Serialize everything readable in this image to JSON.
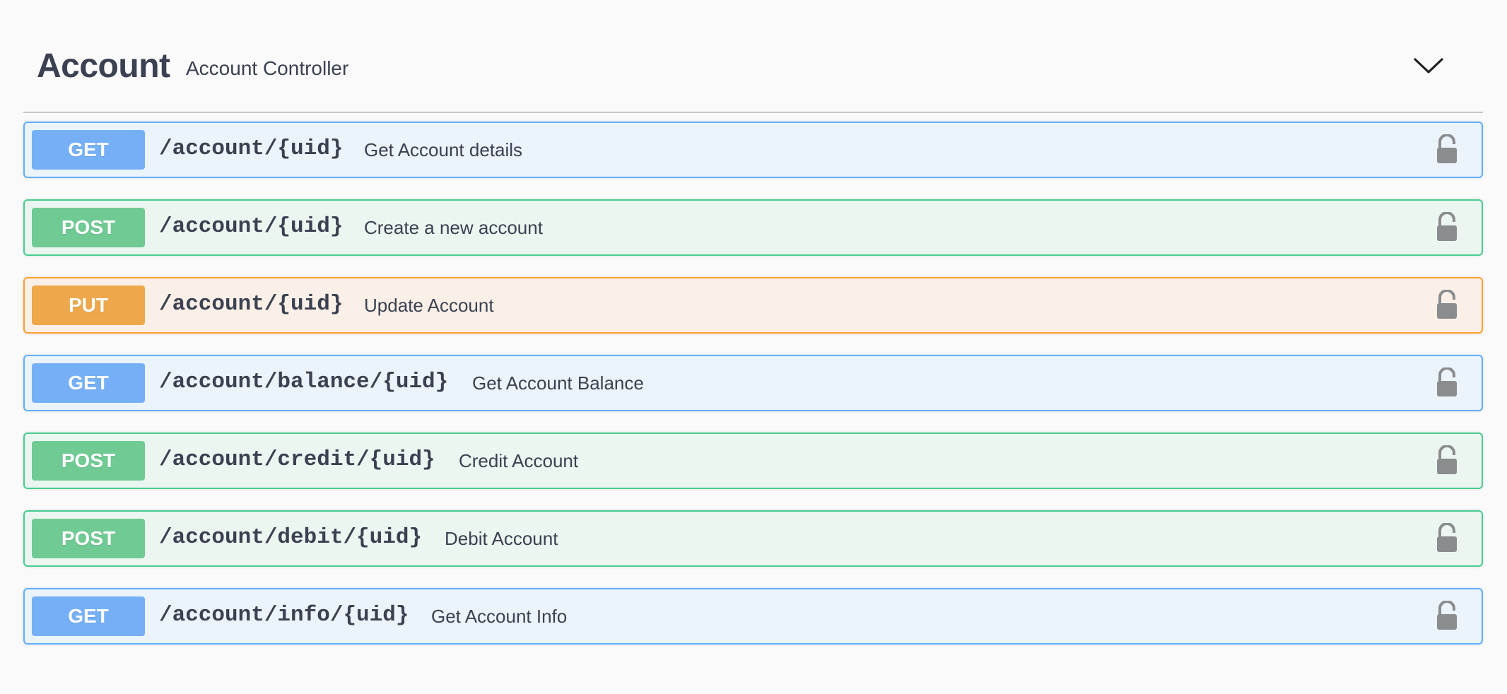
{
  "tag": {
    "title": "Account",
    "description": "Account Controller",
    "expand_icon": "chevron-down-icon"
  },
  "operations": [
    {
      "method": "GET",
      "path": "/account/{uid}",
      "summary": "Get Account details",
      "lock_icon": "unlocked-padlock-icon"
    },
    {
      "method": "POST",
      "path": "/account/{uid}",
      "summary": "Create a new account",
      "lock_icon": "unlocked-padlock-icon"
    },
    {
      "method": "PUT",
      "path": "/account/{uid}",
      "summary": "Update Account",
      "lock_icon": "unlocked-padlock-icon"
    },
    {
      "method": "GET",
      "path": "/account/balance/{uid}",
      "summary": "Get Account Balance",
      "lock_icon": "unlocked-padlock-icon"
    },
    {
      "method": "POST",
      "path": "/account/credit/{uid}",
      "summary": "Credit Account",
      "lock_icon": "unlocked-padlock-icon"
    },
    {
      "method": "POST",
      "path": "/account/debit/{uid}",
      "summary": "Debit Account",
      "lock_icon": "unlocked-padlock-icon"
    },
    {
      "method": "GET",
      "path": "/account/info/{uid}",
      "summary": "Get Account Info",
      "lock_icon": "unlocked-padlock-icon"
    }
  ],
  "colors": {
    "get_border": "#61affe",
    "get_background": "#ebf3fb",
    "get_badge": "#75b0f7",
    "post_border": "#49cc90",
    "post_background": "#ebf6f1",
    "post_badge": "#6fca93",
    "put_border": "#fca130",
    "put_background": "#faf0e7",
    "put_badge": "#eea74a",
    "text": "#3b4151",
    "lock_icon": "#8a8c8e"
  }
}
